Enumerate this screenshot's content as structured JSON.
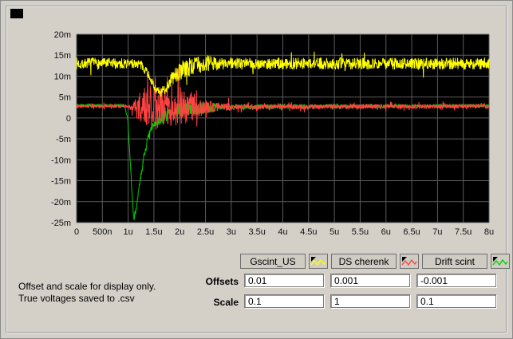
{
  "window": {
    "bg": "#d4d0c8"
  },
  "note": {
    "line1": "Offset and scale for display only.",
    "line2": "True voltages saved to .csv"
  },
  "controls": {
    "offsets_label": "Offsets",
    "scale_label": "Scale",
    "offsets": [
      "0.01",
      "0.001",
      "-0.001"
    ],
    "scale": [
      "0.1",
      "1",
      "0.1"
    ]
  },
  "legend": [
    {
      "label": "Gscint_US",
      "color": "#ffff00"
    },
    {
      "label": "DS cherenk",
      "color": "#ff4242"
    },
    {
      "label": "Drift scint",
      "color": "#00cf00"
    }
  ],
  "chart_data": {
    "type": "line",
    "title": "",
    "xlabel": "",
    "ylabel": "",
    "bg": "#000000",
    "grid_color": "#5c5c5c",
    "grid": true,
    "legend_position": "bottom-right",
    "xlim_us": [
      0,
      8
    ],
    "ylim_mv": [
      -25,
      20
    ],
    "x_ticks": [
      {
        "label": "0",
        "v": 0
      },
      {
        "label": "500n",
        "v": 0.5
      },
      {
        "label": "1u",
        "v": 1
      },
      {
        "label": "1.5u",
        "v": 1.5
      },
      {
        "label": "2u",
        "v": 2
      },
      {
        "label": "2.5u",
        "v": 2.5
      },
      {
        "label": "3u",
        "v": 3
      },
      {
        "label": "3.5u",
        "v": 3.5
      },
      {
        "label": "4u",
        "v": 4
      },
      {
        "label": "4.5u",
        "v": 4.5
      },
      {
        "label": "5u",
        "v": 5
      },
      {
        "label": "5.5u",
        "v": 5.5
      },
      {
        "label": "6u",
        "v": 6
      },
      {
        "label": "6.5u",
        "v": 6.5
      },
      {
        "label": "7u",
        "v": 7
      },
      {
        "label": "7.5u",
        "v": 7.5
      },
      {
        "label": "8u",
        "v": 8
      }
    ],
    "y_ticks": [
      {
        "label": "20m",
        "v": 20
      },
      {
        "label": "15m",
        "v": 15
      },
      {
        "label": "10m",
        "v": 10
      },
      {
        "label": "5m",
        "v": 5
      },
      {
        "label": "0",
        "v": 0
      },
      {
        "label": "-5m",
        "v": -5
      },
      {
        "label": "-10m",
        "v": -10
      },
      {
        "label": "-15m",
        "v": -15
      },
      {
        "label": "-20m",
        "v": -20
      },
      {
        "label": "-25m",
        "v": -25
      }
    ],
    "series": [
      {
        "name": "Gscint_US",
        "color": "#ffff00",
        "z": 3,
        "seed": 7,
        "spike_prob": 0.02,
        "spike_mult": 1.6,
        "mean_mv": [
          [
            0,
            13
          ],
          [
            1.2,
            13
          ],
          [
            1.35,
            11.5
          ],
          [
            1.5,
            7.5
          ],
          [
            1.62,
            5.8
          ],
          [
            1.72,
            7
          ],
          [
            1.85,
            9.5
          ],
          [
            2.05,
            11.5
          ],
          [
            2.3,
            12.7
          ],
          [
            2.6,
            13
          ],
          [
            8,
            13
          ]
        ],
        "noise_mv": [
          [
            0,
            1.4
          ],
          [
            1.25,
            1.2
          ],
          [
            1.55,
            0.9
          ],
          [
            1.8,
            1.6
          ],
          [
            2.0,
            2.3
          ],
          [
            2.45,
            2.1
          ],
          [
            2.8,
            1.5
          ],
          [
            3.2,
            1.4
          ],
          [
            8,
            1.4
          ]
        ]
      },
      {
        "name": "DS cherenk",
        "color": "#ff4242",
        "z": 2,
        "seed": 3,
        "spike_prob": 0.1,
        "spike_mult": 1.8,
        "mean_mv": [
          [
            0,
            2.8
          ],
          [
            1.1,
            2.8
          ],
          [
            1.3,
            2.5
          ],
          [
            1.6,
            2.5
          ],
          [
            2.0,
            2.5
          ],
          [
            2.4,
            2.6
          ],
          [
            8,
            2.8
          ]
        ],
        "noise_mv": [
          [
            0,
            0.35
          ],
          [
            1.05,
            0.4
          ],
          [
            1.18,
            2.5
          ],
          [
            1.3,
            5
          ],
          [
            1.5,
            5.5
          ],
          [
            1.75,
            4.5
          ],
          [
            2.0,
            4.2
          ],
          [
            2.25,
            3.5
          ],
          [
            2.45,
            2.2
          ],
          [
            2.65,
            1.2
          ],
          [
            3.0,
            0.8
          ],
          [
            3.5,
            0.6
          ],
          [
            8,
            0.5
          ]
        ]
      },
      {
        "name": "Drift scint",
        "color": "#00cf00",
        "z": 1,
        "seed": 11,
        "spike_prob": 0.04,
        "spike_mult": 1.5,
        "mean_mv": [
          [
            0,
            3
          ],
          [
            0.93,
            3
          ],
          [
            0.99,
            0
          ],
          [
            1.03,
            -8
          ],
          [
            1.07,
            -17
          ],
          [
            1.11,
            -24
          ],
          [
            1.16,
            -21.5
          ],
          [
            1.22,
            -16
          ],
          [
            1.3,
            -9.5
          ],
          [
            1.4,
            -4
          ],
          [
            1.52,
            -1
          ],
          [
            1.7,
            0.8
          ],
          [
            1.95,
            1.8
          ],
          [
            2.3,
            2.3
          ],
          [
            3.0,
            2.7
          ],
          [
            8,
            2.9
          ]
        ],
        "noise_mv": [
          [
            0,
            0.3
          ],
          [
            0.9,
            0.3
          ],
          [
            1.1,
            0.6
          ],
          [
            1.5,
            1.0
          ],
          [
            1.65,
            1.8
          ],
          [
            2.1,
            1.8
          ],
          [
            2.6,
            1.2
          ],
          [
            3.1,
            0.6
          ],
          [
            8,
            0.35
          ]
        ]
      }
    ]
  }
}
